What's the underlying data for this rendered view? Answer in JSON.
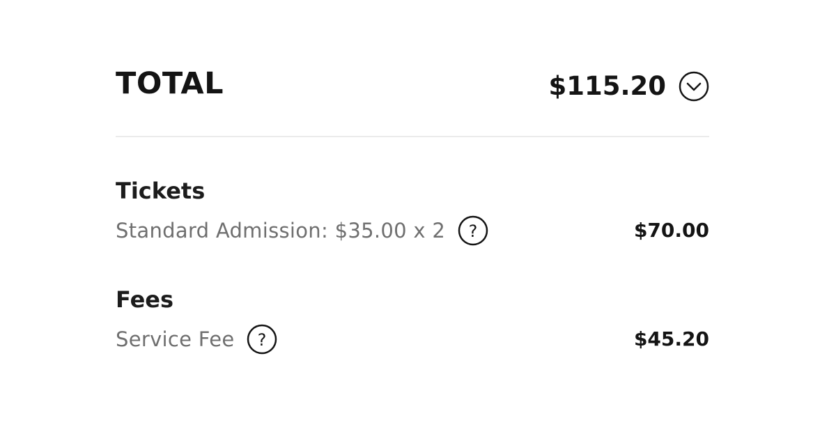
{
  "summary": {
    "total_label": "TOTAL",
    "total_amount": "$115.20",
    "toggle_icon": "chevron-down-circle-icon"
  },
  "sections": [
    {
      "title": "Tickets",
      "items": [
        {
          "description": "Standard Admission: $35.00 x 2",
          "help_icon": "question-circle-icon",
          "amount": "$70.00"
        }
      ]
    },
    {
      "title": "Fees",
      "items": [
        {
          "description": "Service Fee",
          "help_icon": "question-circle-icon",
          "amount": "$45.20"
        }
      ]
    }
  ],
  "colors": {
    "text_primary": "#141414",
    "text_secondary": "#6f6f6f",
    "divider": "#ebebeb",
    "background": "#ffffff"
  }
}
